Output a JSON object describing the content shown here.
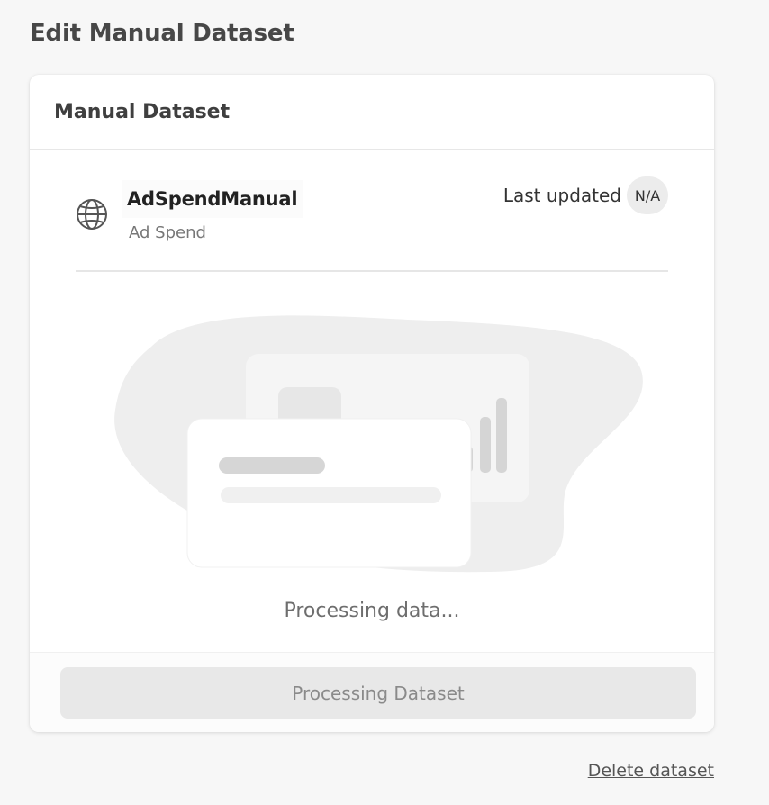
{
  "page": {
    "title": "Edit Manual Dataset"
  },
  "card": {
    "header_title": "Manual Dataset",
    "dataset": {
      "name": "AdSpendManual",
      "type": "Ad Spend",
      "icon": "globe-icon",
      "last_updated_label": "Last updated",
      "last_updated_value": "N/A"
    },
    "status_text": "Processing data...",
    "button_label": "Processing Dataset"
  },
  "delete_link": "Delete dataset",
  "colors": {
    "background": "#f7f7f7",
    "card": "#ffffff",
    "button_disabled": "#e8e8e8",
    "illustration_blob": "#eeeeee"
  }
}
